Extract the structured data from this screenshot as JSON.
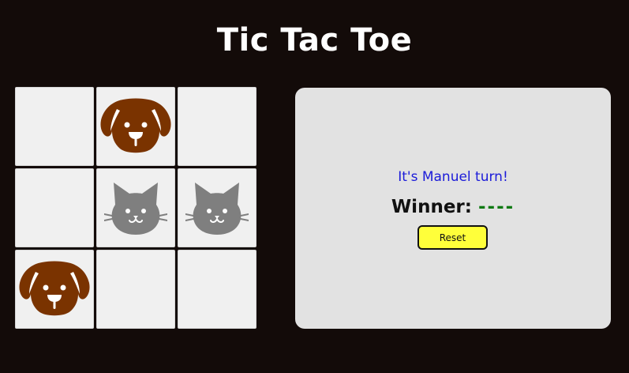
{
  "title": "Tic Tac Toe",
  "colors": {
    "background": "#130b09",
    "cell": "#f0f0f0",
    "dog": "#7a3300",
    "cat": "#7f7f7f",
    "panel": "#e2e2e2",
    "turn_text": "#1b1bd9",
    "winner_value": "#0f7a13",
    "reset_button": "#ffff3a"
  },
  "board": [
    [
      "",
      "dog",
      ""
    ],
    [
      "",
      "cat",
      "cat"
    ],
    [
      "dog",
      "",
      ""
    ]
  ],
  "players": {
    "dog": {
      "icon": "dog-icon"
    },
    "cat": {
      "icon": "cat-icon"
    }
  },
  "status": {
    "turn_text": "It's Manuel turn!",
    "winner_label": "Winner:",
    "winner_value": "----"
  },
  "reset_label": "Reset"
}
